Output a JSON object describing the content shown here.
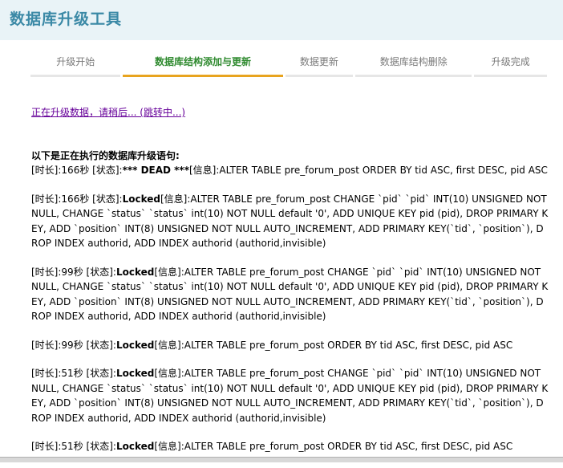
{
  "app": {
    "title": "数据库升级工具"
  },
  "steps": [
    {
      "label": "升级开始",
      "active": false
    },
    {
      "label": "数据库结构添加与更新",
      "active": true
    },
    {
      "label": "数据更新",
      "active": false
    },
    {
      "label": "数据库结构删除",
      "active": false
    },
    {
      "label": "升级完成",
      "active": false
    }
  ],
  "redirect": {
    "text": "正在升级数据，请稍后... (跳转中...)"
  },
  "sql_heading": "以下是正在执行的数据库升级语句:",
  "log": [
    {
      "time_label": "[时长]:",
      "time": "166秒",
      "state_label": " [状态]:",
      "state": "*** DEAD ***",
      "info_label": "[信息]:",
      "info": "ALTER TABLE pre_forum_post ORDER BY tid ASC, first DESC, pid ASC"
    },
    {
      "time_label": "[时长]:",
      "time": "166秒",
      "state_label": " [状态]:",
      "state": "Locked",
      "info_label": "[信息]:",
      "info": "ALTER TABLE pre_forum_post CHANGE `pid` `pid` INT(10) UNSIGNED NOT NULL, CHANGE `status` `status` int(10) NOT NULL default '0', ADD UNIQUE KEY pid (pid), DROP PRIMARY KEY, ADD `position` INT(8) UNSIGNED NOT NULL AUTO_INCREMENT, ADD PRIMARY KEY(`tid`, `position`), DROP INDEX authorid, ADD INDEX authorid (authorid,invisible)"
    },
    {
      "time_label": "[时长]:",
      "time": "99秒",
      "state_label": " [状态]:",
      "state": "Locked",
      "info_label": "[信息]:",
      "info": "ALTER TABLE pre_forum_post CHANGE `pid` `pid` INT(10) UNSIGNED NOT NULL, CHANGE `status` `status` int(10) NOT NULL default '0', ADD UNIQUE KEY pid (pid), DROP PRIMARY KEY, ADD `position` INT(8) UNSIGNED NOT NULL AUTO_INCREMENT, ADD PRIMARY KEY(`tid`, `position`), DROP INDEX authorid, ADD INDEX authorid (authorid,invisible)"
    },
    {
      "time_label": "[时长]:",
      "time": "99秒",
      "state_label": " [状态]:",
      "state": "Locked",
      "info_label": "[信息]:",
      "info": "ALTER TABLE pre_forum_post ORDER BY tid ASC, first DESC, pid ASC"
    },
    {
      "time_label": "[时长]:",
      "time": "51秒",
      "state_label": " [状态]:",
      "state": "Locked",
      "info_label": "[信息]:",
      "info": "ALTER TABLE pre_forum_post CHANGE `pid` `pid` INT(10) UNSIGNED NOT NULL, CHANGE `status` `status` int(10) NOT NULL default '0', ADD UNIQUE KEY pid (pid), DROP PRIMARY KEY, ADD `position` INT(8) UNSIGNED NOT NULL AUTO_INCREMENT, ADD PRIMARY KEY(`tid`, `position`), DROP INDEX authorid, ADD INDEX authorid (authorid,invisible)"
    },
    {
      "time_label": "[时长]:",
      "time": "51秒",
      "state_label": " [状态]:",
      "state": "Locked",
      "info_label": "[信息]:",
      "info": "ALTER TABLE pre_forum_post ORDER BY tid ASC, first DESC, pid ASC"
    }
  ]
}
